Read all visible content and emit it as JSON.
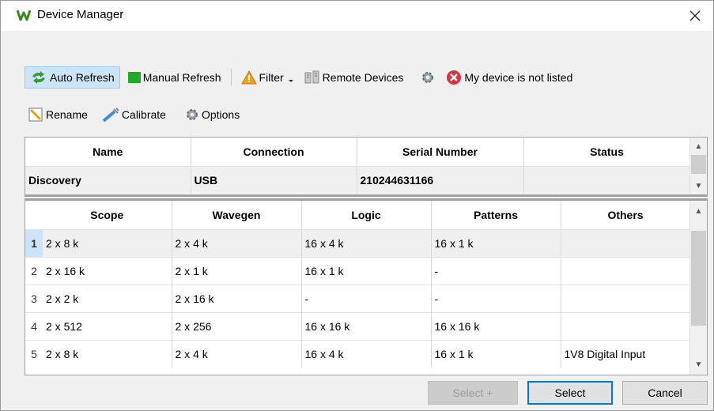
{
  "window": {
    "title": "Device Manager",
    "logo_icon": "waveforms-w-icon",
    "close_glyph": "✕"
  },
  "toolbar": {
    "auto_refresh": "Auto Refresh",
    "manual_refresh": "Manual Refresh",
    "filter": "Filter",
    "remote_devices": "Remote Devices",
    "not_listed": "My device is not listed",
    "rename": "Rename",
    "calibrate": "Calibrate",
    "options": "Options"
  },
  "device_table": {
    "headers": [
      "Name",
      "Connection",
      "Serial Number",
      "Status"
    ],
    "rows": [
      [
        "Discovery",
        "USB",
        "210244631166",
        ""
      ]
    ]
  },
  "config_table": {
    "headers": [
      "Scope",
      "Wavegen",
      "Logic",
      "Patterns",
      "Others"
    ],
    "rows": [
      [
        "1",
        "2 x 8 k",
        "2 x 4 k",
        "16 x 4 k",
        "16 x 1 k",
        ""
      ],
      [
        "2",
        "2 x 16 k",
        "2 x 1 k",
        "16 x 1 k",
        "-",
        ""
      ],
      [
        "3",
        "2 x 2 k",
        "2 x 16 k",
        "-",
        "-",
        ""
      ],
      [
        "4",
        "2 x 512",
        "2 x 256",
        "16 x 16 k",
        "16 x 16 k",
        ""
      ],
      [
        "5",
        "2 x 8 k",
        "2 x 4 k",
        "16 x 4 k",
        "16 x 1 k",
        "1V8 Digital Input"
      ]
    ]
  },
  "footer": {
    "select_plus": "Select +",
    "select": "Select",
    "cancel": "Cancel"
  },
  "colors": {
    "accent": "#0078d7",
    "selection": "#cce4f7",
    "logo": "#3a8a1f",
    "error": "#d9333f",
    "warning": "#f0a020"
  }
}
